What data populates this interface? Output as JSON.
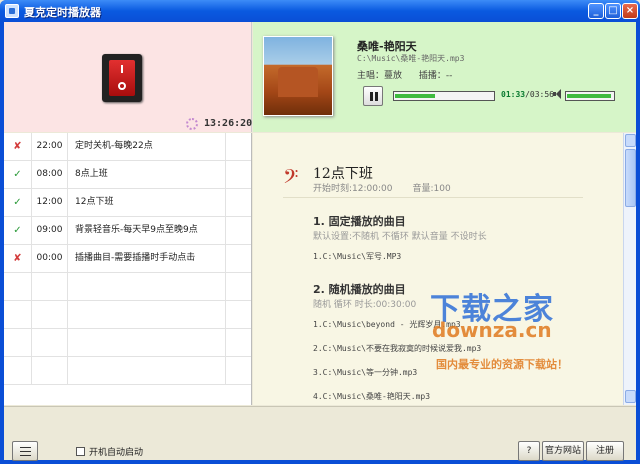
{
  "window": {
    "title": "夏克定时播放器",
    "buttons": {
      "minimize": "_",
      "maximize": "□",
      "close": "×"
    }
  },
  "header": {
    "clock": "13:26:20",
    "now_playing": {
      "title": "桑唯-艳阳天",
      "path": "C:\\Music\\桑唯-艳阳天.mp3",
      "singer_label": "主唱：",
      "singer_value": "蔓放",
      "album_label": "插播：",
      "album_value": "--",
      "elapsed": "01:33",
      "total": "/03:56",
      "progress": 0.4,
      "volume": 0.95
    }
  },
  "schedule": {
    "rows": [
      {
        "status": "✘",
        "status_type": "off",
        "time": "22:00",
        "name": "定时关机-每晚22点"
      },
      {
        "status": "✓",
        "status_type": "on",
        "time": "08:00",
        "name": "8点上班"
      },
      {
        "status": "✓",
        "status_type": "on",
        "time": "12:00",
        "name": "12点下班"
      },
      {
        "status": "✓",
        "status_type": "on",
        "time": "09:00",
        "name": "背景轻音乐-每天早9点至晚9点"
      },
      {
        "status": "✘",
        "status_type": "off",
        "time": "00:00",
        "name": "插播曲目-需要插播时手动点击"
      }
    ],
    "empty_rows": 4
  },
  "detail": {
    "title": "12点下班",
    "start_label": "开始时刻:12:00:00",
    "volume_label": "音量:100",
    "section1": {
      "title": "1. 固定播放的曲目",
      "sub": "默认设置:不随机 不循环 默认音量 不设时长",
      "tracks": [
        "1.C:\\Music\\军号.MP3"
      ]
    },
    "section2": {
      "title": "2. 随机播放的曲目",
      "sub": "随机  循环  时长:00:30:00",
      "tracks": [
        "1.C:\\Music\\beyond - 光辉岁月.mp3",
        "2.C:\\Music\\不要在我寂寞的时候说爱我.mp3",
        "3.C:\\Music\\等一分钟.mp3",
        "4.C:\\Music\\桑唯-艳阳天.mp3"
      ]
    }
  },
  "watermark": {
    "line1": "下载之家",
    "line2": "downza.cn",
    "line3": "国内最专业的资源下载站！"
  },
  "footer": {
    "autostart_label": "开机自动启动",
    "help_label": "?",
    "site_label": "官方网站",
    "register_label": "注册"
  },
  "colors": {
    "title_bar": "#0a4ed6",
    "header_left": "#fce4e4",
    "header_right": "#d6f5c8",
    "detail_bg": "#f8f6e4",
    "progress": "#3fba3f",
    "status_off": "#d33b3b",
    "status_on": "#2c9a3a"
  }
}
